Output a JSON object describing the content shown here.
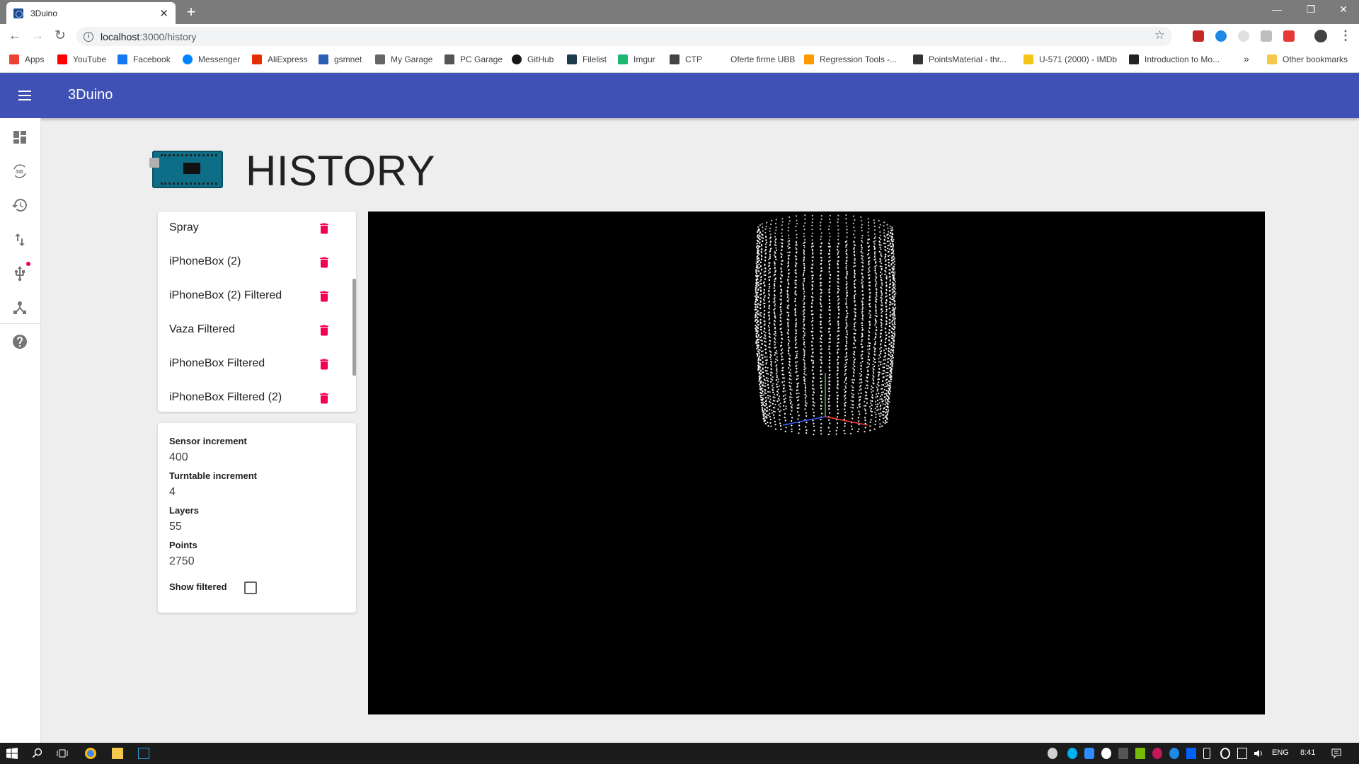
{
  "browser": {
    "tab_title": "3Duino",
    "tab_close": "✕",
    "new_tab": "+",
    "url_host": "localhost",
    "url_path": ":3000/history",
    "window_controls": [
      "—",
      "❐",
      "✕"
    ],
    "bookmarks": [
      {
        "label": "Apps",
        "color": "#ea4335"
      },
      {
        "label": "YouTube",
        "color": "#ff0000"
      },
      {
        "label": "Facebook",
        "color": "#1877f2"
      },
      {
        "label": "Messenger",
        "color": "#0084ff"
      },
      {
        "label": "AliExpress",
        "color": "#e62e04"
      },
      {
        "label": "gsmnet",
        "color": "#2b5fb4"
      },
      {
        "label": "My Garage",
        "color": "#666666"
      },
      {
        "label": "PC Garage",
        "color": "#555555"
      },
      {
        "label": "GitHub",
        "color": "#181717"
      },
      {
        "label": "Filelist",
        "color": "#1d3a4a"
      },
      {
        "label": "Imgur",
        "color": "#1bb76e"
      },
      {
        "label": "CTP",
        "color": "#444444"
      },
      {
        "label": "Oferte firme UBB",
        "color": "#ffffff"
      },
      {
        "label": "Regression Tools -...",
        "color": "#ff9900"
      },
      {
        "label": "PointsMaterial - thr...",
        "color": "#333333"
      },
      {
        "label": "U-571 (2000) - IMDb",
        "color": "#f5c518"
      },
      {
        "label": "Introduction to Mo...",
        "color": "#222222"
      }
    ],
    "more_bookmarks": "»",
    "other_bookmarks": "Other bookmarks"
  },
  "app": {
    "title": "3Duino",
    "page_title": "HISTORY",
    "accent": "#3f51b5",
    "delete_color": "#f50057"
  },
  "scans": [
    {
      "name": "Spray"
    },
    {
      "name": "iPhoneBox (2)"
    },
    {
      "name": "iPhoneBox (2) Filtered"
    },
    {
      "name": "Vaza Filtered"
    },
    {
      "name": "iPhoneBox Filtered"
    },
    {
      "name": "iPhoneBox Filtered (2)"
    }
  ],
  "details": {
    "sensor_increment_label": "Sensor increment",
    "sensor_increment": "400",
    "turntable_increment_label": "Turntable increment",
    "turntable_increment": "4",
    "layers_label": "Layers",
    "layers": "55",
    "points_label": "Points",
    "points": "2750",
    "show_filtered_label": "Show filtered",
    "show_filtered": false
  },
  "viewer": {
    "background": "#000000",
    "point_color": "#ffffff",
    "layers": 55,
    "points_per_layer": 50,
    "axis_colors": {
      "x": "#ff3b3b",
      "y": "#3bd13b",
      "z": "#3b5bff"
    }
  },
  "taskbar": {
    "language": "ENG",
    "time": "8:41"
  }
}
